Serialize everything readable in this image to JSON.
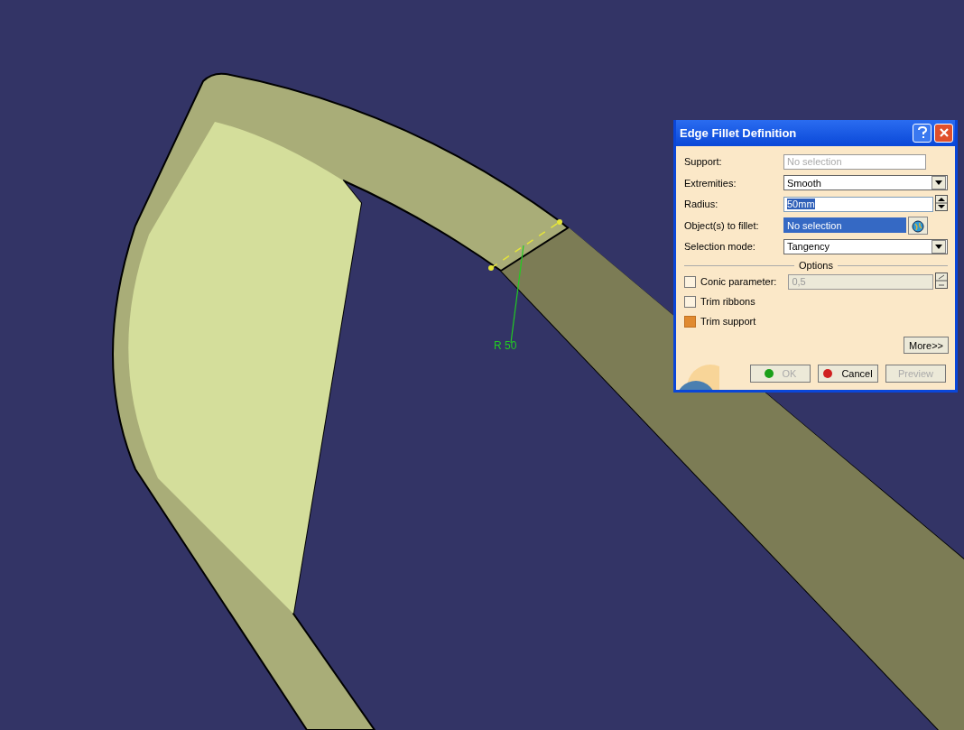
{
  "viewport": {
    "dimension_label": "R 50"
  },
  "dialog": {
    "title": "Edge Fillet Definition",
    "fields": [
      {
        "kind": "readonly",
        "label": "Support:",
        "placeholder": "No selection"
      },
      {
        "kind": "dropdown",
        "label": "Extremities:",
        "value": "Smooth"
      },
      {
        "kind": "spinner",
        "label": "Radius:",
        "value": "50mm"
      },
      {
        "kind": "selector",
        "label": "Object(s) to fillet:",
        "value": "No selection"
      },
      {
        "kind": "dropdown",
        "label": "Selection mode:",
        "value": "Tangency"
      }
    ],
    "options_title": "Options",
    "options": [
      {
        "label": "Conic parameter:",
        "checked": false,
        "value": "0,5",
        "disabled": true
      },
      {
        "label": "Trim ribbons",
        "checked": false
      },
      {
        "label": "Trim support",
        "checked": true
      }
    ],
    "more_button": "More>>",
    "buttons": [
      {
        "kind": "ok",
        "label": "OK",
        "disabled": true
      },
      {
        "kind": "cancel",
        "label": "Cancel",
        "disabled": false
      },
      {
        "kind": "preview",
        "label": "Preview",
        "disabled": true
      }
    ]
  }
}
